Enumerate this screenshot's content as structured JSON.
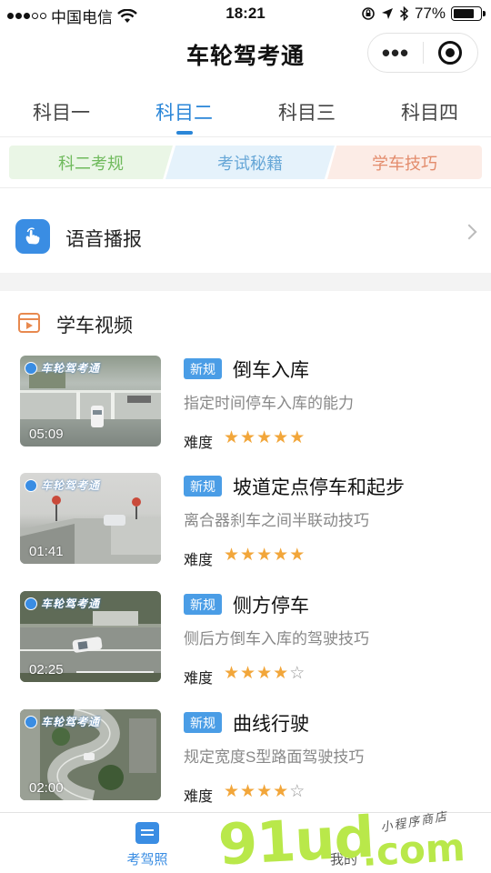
{
  "status_bar": {
    "carrier": "中国电信",
    "time": "18:21",
    "battery_percent": "77%",
    "battery_level": 0.77
  },
  "nav": {
    "title": "车轮驾考通",
    "more_label": "•••"
  },
  "subject_tabs": [
    {
      "label": "科目一",
      "active": false
    },
    {
      "label": "科目二",
      "active": true
    },
    {
      "label": "科目三",
      "active": false
    },
    {
      "label": "科目四",
      "active": false
    }
  ],
  "categories": [
    {
      "label": "科二考规",
      "color": "#6fba5c"
    },
    {
      "label": "考试秘籍",
      "color": "#67a7d7"
    },
    {
      "label": "学车技巧",
      "color": "#e38c6c"
    }
  ],
  "voice_row": {
    "label": "语音播报",
    "icon": "hand-tap-icon"
  },
  "section": {
    "title": "学车视频",
    "icon": "video-icon"
  },
  "videos": [
    {
      "badge": "新规",
      "title": "倒车入库",
      "desc": "指定时间停车入库的能力",
      "difficulty_label": "难度",
      "rating": 5,
      "duration": "05:09",
      "thumb_logo": "车轮驾考通"
    },
    {
      "badge": "新规",
      "title": "坡道定点停车和起步",
      "desc": "离合器刹车之间半联动技巧",
      "difficulty_label": "难度",
      "rating": 5,
      "duration": "01:41",
      "thumb_logo": "车轮驾考通"
    },
    {
      "badge": "新规",
      "title": "侧方停车",
      "desc": "侧后方倒车入库的驾驶技巧",
      "difficulty_label": "难度",
      "rating": 4,
      "duration": "02:25",
      "thumb_logo": "车轮驾考通"
    },
    {
      "badge": "新规",
      "title": "曲线行驶",
      "desc": "规定宽度S型路面驾驶技巧",
      "difficulty_label": "难度",
      "rating": 4,
      "duration": "02:00",
      "thumb_logo": "车轮驾考通"
    }
  ],
  "tabbar": [
    {
      "label": "考驾照",
      "active": true,
      "icon": "license-card-icon"
    },
    {
      "label": "我的",
      "active": false,
      "icon": "user-icon"
    }
  ],
  "watermark": {
    "main": "91ud",
    "com": ".com",
    "small": "小程序商店"
  },
  "colors": {
    "accent": "#2a86d8",
    "badge": "#4a9de6",
    "star_on": "#f2a63a",
    "star_off": "#999999"
  }
}
